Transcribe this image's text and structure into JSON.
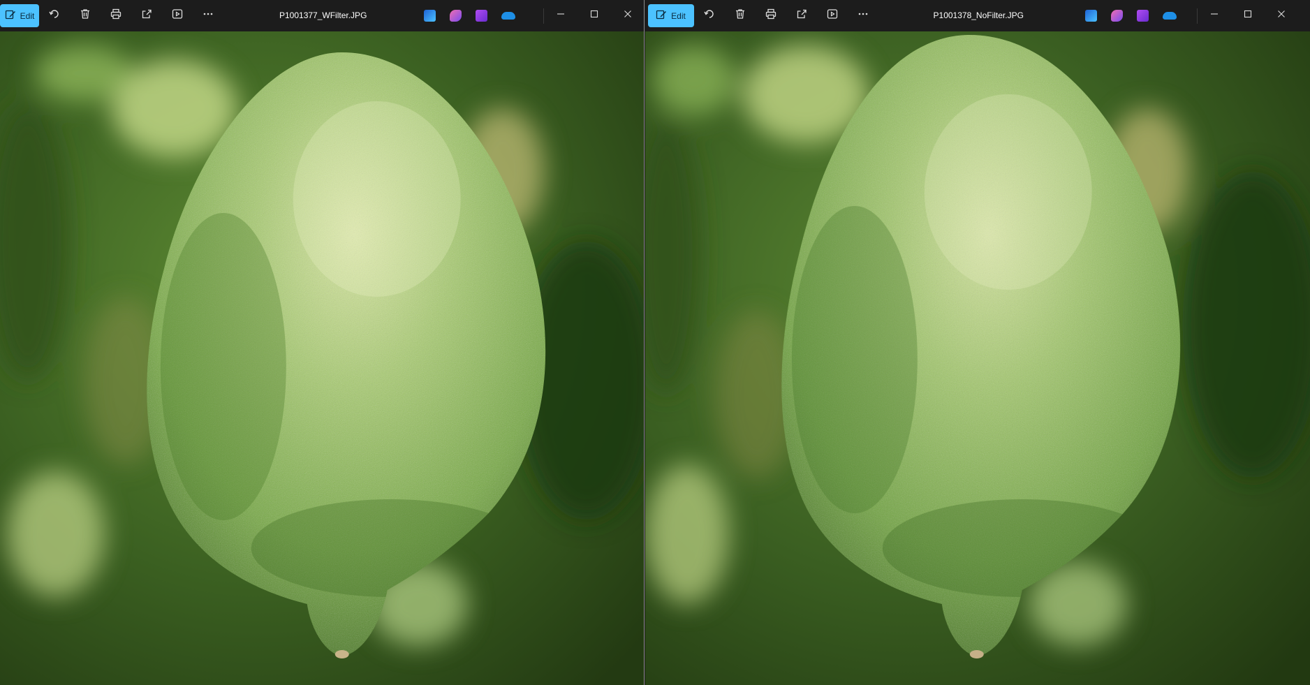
{
  "left": {
    "edit_label": "Edit",
    "filename": "P1001377_WFilter.JPG"
  },
  "right": {
    "edit_label": "Edit",
    "filename": "P1001378_NoFilter.JPG"
  },
  "colors": {
    "accent": "#4cc2ff",
    "titlebar": "#1c1c1c",
    "fruit": "#9cc26a",
    "foliage": "#3d6324"
  },
  "icons": [
    "edit-icon",
    "rotate-icon",
    "delete-icon",
    "print-icon",
    "share-icon",
    "slideshow-icon",
    "more-icon",
    "designer-icon",
    "copilot-icon",
    "clipchamp-icon",
    "onedrive-icon",
    "minimize-icon",
    "maximize-icon",
    "close-icon"
  ]
}
